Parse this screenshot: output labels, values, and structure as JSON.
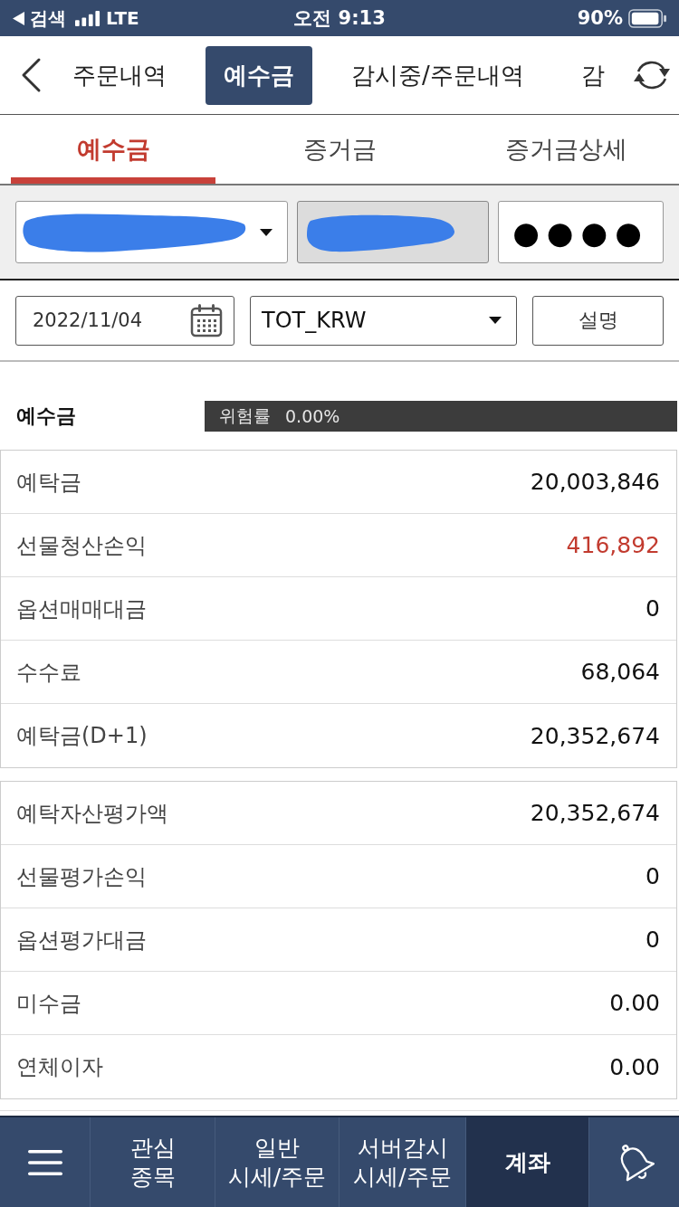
{
  "status_bar": {
    "back_app": "검색",
    "network": "LTE",
    "time": "오전 9:13",
    "battery": "90%"
  },
  "nav": {
    "tabs": [
      {
        "label": "주문내역",
        "selected": false
      },
      {
        "label": "예수금",
        "selected": true
      },
      {
        "label": "감시중/주문내역",
        "selected": false
      },
      {
        "label": "감",
        "selected": false
      }
    ]
  },
  "sub_tabs": [
    {
      "label": "예수금",
      "selected": true
    },
    {
      "label": "증거금",
      "selected": false
    },
    {
      "label": "증거금상세",
      "selected": false
    }
  ],
  "account": {
    "fields": [
      {
        "kind": "dropdown",
        "redacted": true
      },
      {
        "kind": "readonly",
        "redacted": true
      },
      {
        "kind": "password",
        "value": "●●●●"
      }
    ]
  },
  "filters": {
    "date": "2022/11/04",
    "currency": "TOT_KRW",
    "button": "설명"
  },
  "summary": {
    "title": "예수금",
    "risk_label": "위험률",
    "risk_value": "0.00%"
  },
  "tables": [
    {
      "rows": [
        {
          "label": "예탁금",
          "value": "20,003,846",
          "color": "#111111"
        },
        {
          "label": "선물청산손익",
          "value": "416,892",
          "color": "#c23b2f"
        },
        {
          "label": "옵션매매대금",
          "value": "0",
          "color": "#111111"
        },
        {
          "label": "수수료",
          "value": "68,064",
          "color": "#111111"
        },
        {
          "label": "예탁금(D+1)",
          "value": "20,352,674",
          "color": "#111111"
        }
      ]
    },
    {
      "rows": [
        {
          "label": "예탁자산평가액",
          "value": "20,352,674",
          "color": "#111111"
        },
        {
          "label": "선물평가손익",
          "value": "0",
          "color": "#111111"
        },
        {
          "label": "옵션평가대금",
          "value": "0",
          "color": "#111111"
        },
        {
          "label": "미수금",
          "value": "0.00",
          "color": "#111111"
        },
        {
          "label": "연체이자",
          "value": "0.00",
          "color": "#111111"
        }
      ]
    }
  ],
  "bottom_nav": [
    {
      "kind": "menu",
      "selected": false
    },
    {
      "kind": "text",
      "lines": [
        "관심",
        "종목"
      ],
      "selected": false
    },
    {
      "kind": "text",
      "lines": [
        "일반",
        "시세/주문"
      ],
      "selected": false
    },
    {
      "kind": "text",
      "lines": [
        "서버감시",
        "시세/주문"
      ],
      "selected": false
    },
    {
      "kind": "text",
      "lines": [
        "계좌"
      ],
      "selected": true
    },
    {
      "kind": "bell",
      "selected": false
    }
  ]
}
